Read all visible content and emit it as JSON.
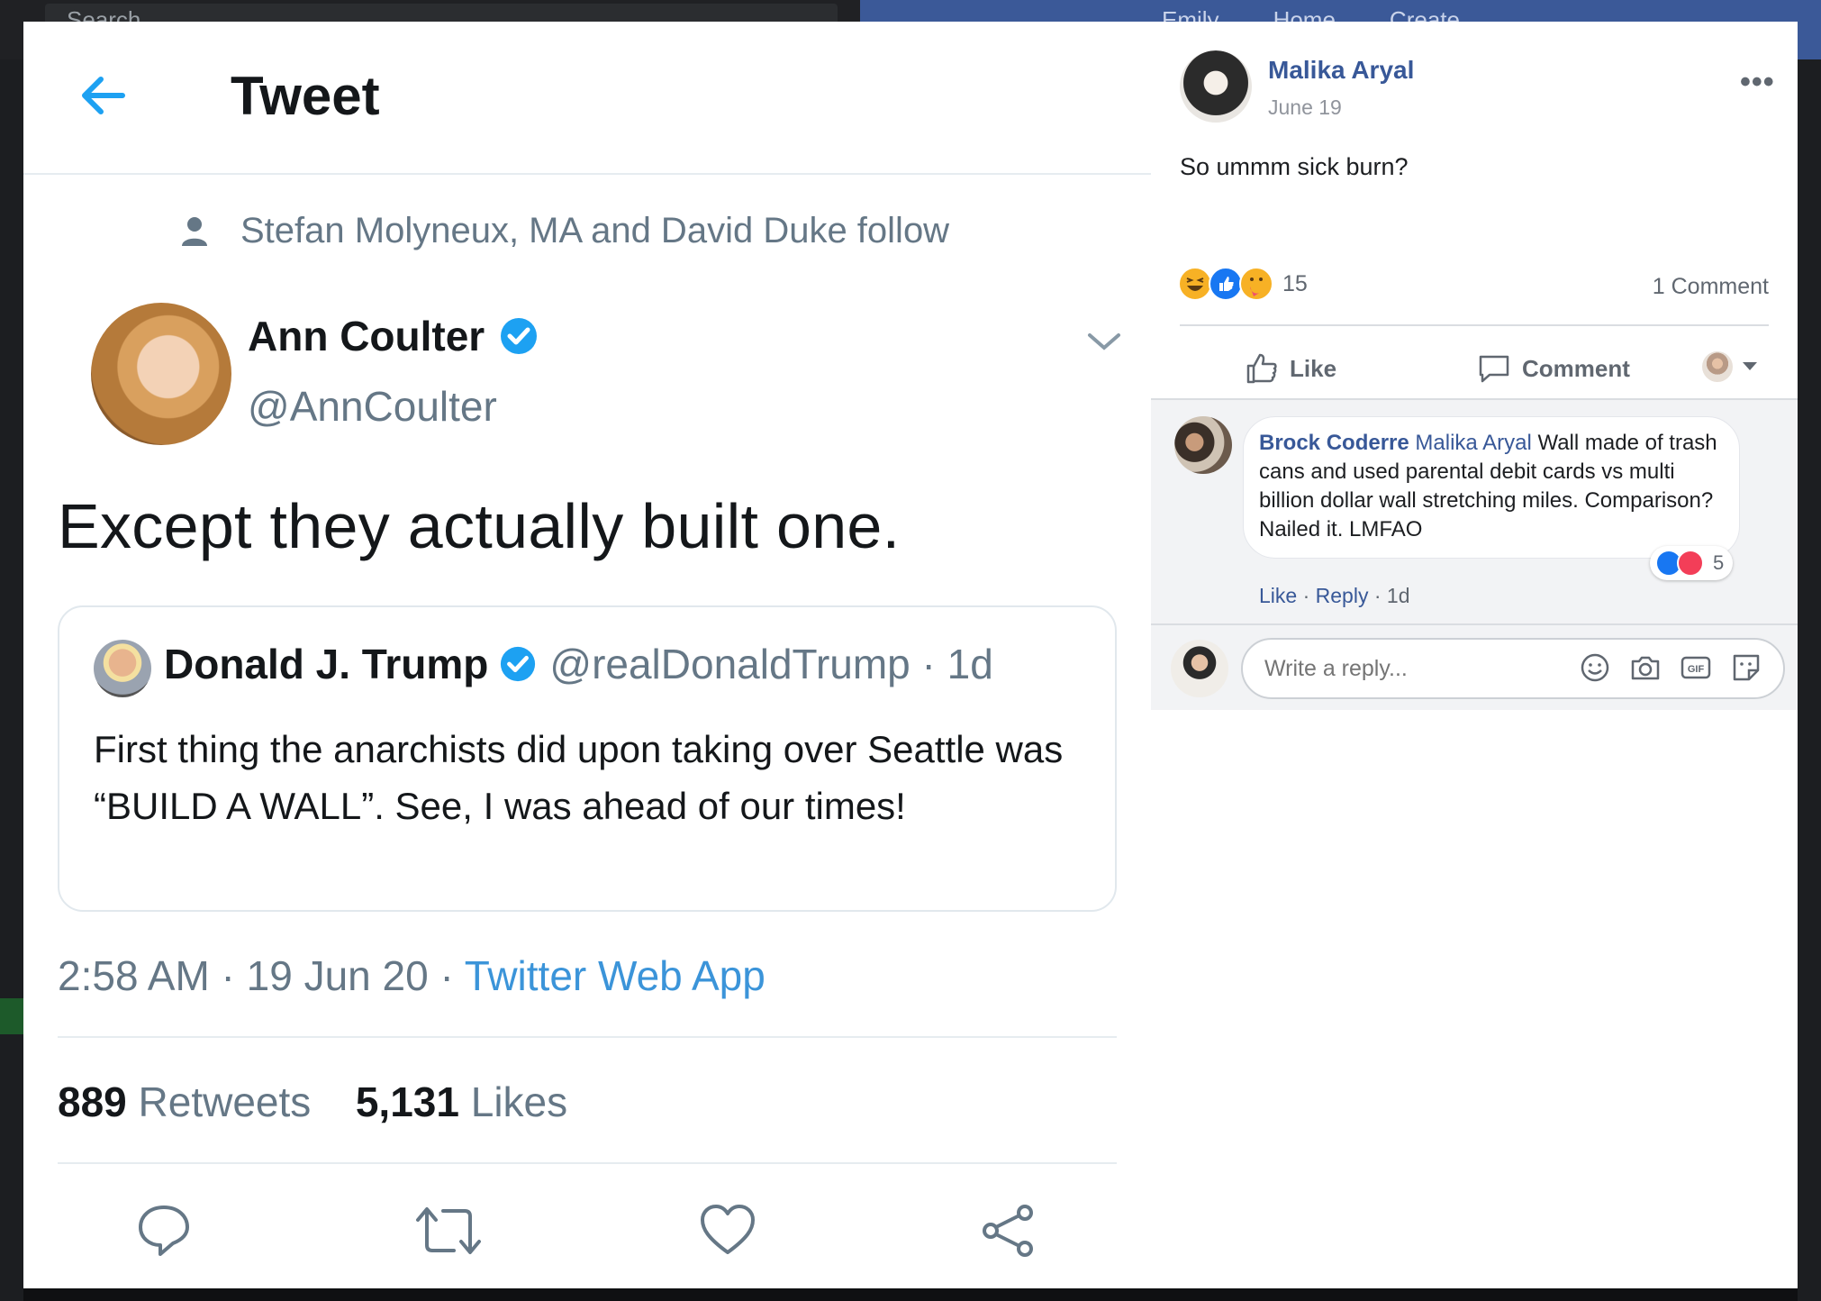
{
  "background": {
    "search_placeholder": "Search",
    "nav_items": [
      "Emily",
      "Home",
      "Create"
    ]
  },
  "tweet": {
    "header_title": "Tweet",
    "social_context": "Stefan Molyneux, MA and David Duke follow",
    "author": {
      "name": "Ann Coulter",
      "handle": "@AnnCoulter",
      "verified": true
    },
    "text": "Except they actually built one.",
    "quoted": {
      "name": "Donald J. Trump",
      "handle": "@realDonaldTrump · 1d",
      "verified": true,
      "text": "First thing the anarchists did upon taking over Seattle was “BUILD A WALL”. See, I was ahead of our times!"
    },
    "time": "2:58 AM · 19 Jun 20 · ",
    "source": "Twitter Web App",
    "retweet_count": "889",
    "retweet_label": "Retweets",
    "like_count": "5,131",
    "like_label": "Likes",
    "accent_color": "#1da1f2"
  },
  "fb_post": {
    "author": "Malika Aryal",
    "date": "June 19",
    "more": "•••",
    "text": "So ummm sick burn?",
    "reactions": [
      "haha",
      "like",
      "care"
    ],
    "reaction_count": "15",
    "comment_count": "1 Comment",
    "like_label": "Like",
    "comment_label": "Comment",
    "link_color": "#385898"
  },
  "comment": {
    "author": "Brock Coderre",
    "tag": "Malika Aryal",
    "text": " Wall made of trash cans and used parental debit cards vs multi billion dollar wall stretching miles. Comparison? Nailed it. LMFAO",
    "reaction_count": "5",
    "like": "Like",
    "reply": "Reply",
    "time": "1d"
  },
  "reply_box": {
    "placeholder": "Write a reply...",
    "icons": [
      "emoji-icon",
      "camera-icon",
      "gif-icon",
      "sticker-icon"
    ]
  }
}
